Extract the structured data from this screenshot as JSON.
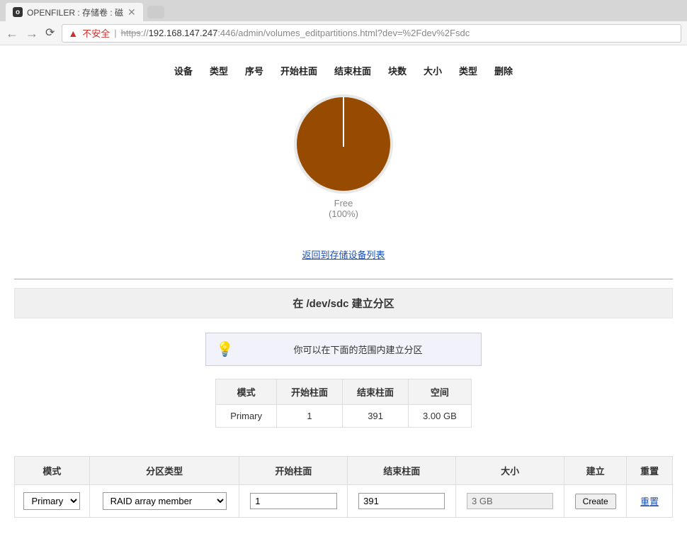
{
  "browser": {
    "tab_title": "OPENFILER : 存储卷 : 磁",
    "back_glyph": "←",
    "fwd_glyph": "→",
    "reload_glyph": "⟳",
    "close_glyph": "✕",
    "warn_glyph": "▲",
    "not_secure_label": "不安全",
    "url_proto": "https",
    "url_sep": "://",
    "url_host": "192.168.147.247",
    "url_rest": ":446/admin/volumes_editpartitions.html?dev=%2Fdev%2Fsdc"
  },
  "partition_header": {
    "cols": [
      "设备",
      "类型",
      "序号",
      "开始柱面",
      "结束柱面",
      "块数",
      "大小",
      "类型",
      "删除"
    ]
  },
  "pie": {
    "label_line1": "Free",
    "label_line2": "(100%)"
  },
  "back_link": "返回到存储设备列表",
  "section_title": "在 /dev/sdc 建立分区",
  "info_text": "你可以在下面的范围内建立分区",
  "range_header": [
    "模式",
    "开始柱面",
    "结束柱面",
    "空间"
  ],
  "range_row": {
    "mode": "Primary",
    "start": "1",
    "end": "391",
    "space": "3.00 GB"
  },
  "form_header": [
    "模式",
    "分区类型",
    "开始柱面",
    "结束柱面",
    "大小",
    "建立",
    "重置"
  ],
  "form": {
    "mode_option": "Primary",
    "type_option": "RAID array member",
    "start_value": "1",
    "end_value": "391",
    "size_value": "3 GB",
    "create_label": "Create",
    "reset_label": "重置"
  },
  "chart_data": {
    "type": "pie",
    "title": "",
    "slices": [
      {
        "name": "Free",
        "value": 100
      }
    ],
    "unit": "%",
    "total": 100
  }
}
